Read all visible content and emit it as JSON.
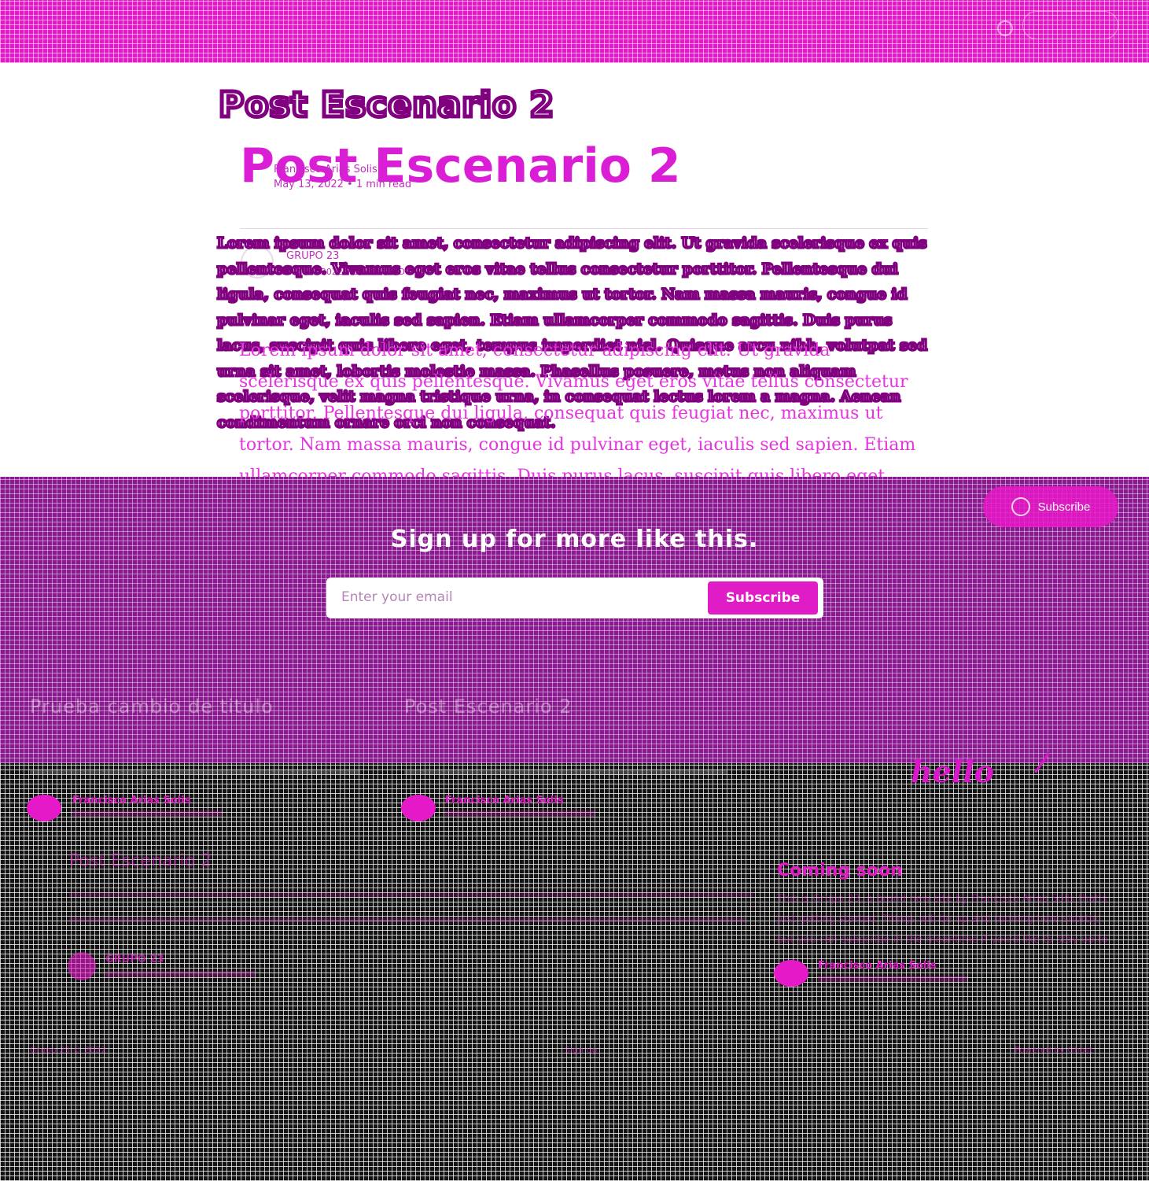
{
  "header": {
    "nav_placeholder": "·",
    "button_label": ""
  },
  "post": {
    "title_outline": "Post Escenario 2",
    "title": "Post Escenario 2",
    "meta_top": {
      "author": "Francisco Arias Solis",
      "date": "May 13, 2022",
      "read_time": "1 min read"
    },
    "meta_bottom": {
      "author": "GRUPO 23",
      "date": "13 MAY 2022",
      "read_time": "1 MIN READ"
    },
    "body_outline": "Lorem ipsum dolor sit amet, consectetur adipiscing elit. Ut gravida scelerisque ex quis pellentesque. Vivamus eget eros vitae tellus consectetur porttitor. Pellentesque dui ligula, consequat quis feugiat nec, maximus ut tortor. Nam massa mauris, congue id pulvinar eget, iaculis sed sapien. Etiam ullamcorper commodo sagittis. Duis purus lacus, suscipit quis libero eget, tempus imperdiet nisl. Quisque arcu nibh, volutpat sed urna sit amet, lobortis molestie massa. Phasellus posuere, metus non aliquam scelerisque, velit magna tristique urna, in consequat lectus lorem a magna. Aenean condimentum ornare orci non consequat.",
    "body": "Lorem ipsum dolor sit amet, consectetur adipiscing elit. Ut gravida scelerisque ex quis pellentesque. Vivamus eget eros vitae tellus consectetur porttitor. Pellentesque dui ligula, consequat quis feugiat nec, maximus ut tortor. Nam massa mauris, congue id pulvinar eget, iaculis sed sapien. Etiam ullamcorper commodo sagittis. Duis purus lacus, suscipit quis libero eget, tempus imperdiet"
  },
  "subscribe": {
    "floating_button": "Subscribe",
    "heading": "Sign up for more like this.",
    "email_placeholder": "Enter your email",
    "button": "Subscribe"
  },
  "related": {
    "left_title": "Prueba cambio de titulo",
    "right_title": "Post Escenario 2"
  },
  "footer": {
    "card_author": "Francisco Arias Solis",
    "featured_title": "Post Escenario 2",
    "featured_author": "GRUPO 23",
    "coming_soon_title": "Coming soon",
    "coming_soon_excerpt": "This is Grupo 23, a brand new site by Francisco Arias Solis that's just getting started. Things will be up and running here shortly, but you can subscribe in the meantime if you'd like to stay up to date and receive emails when new content is published!",
    "coming_soon_author": "Francisco Arias Solis",
    "hello_text": "hello",
    "left_link": "Grupo 23 © 2022",
    "center_link": "Sign up",
    "right_link": "Powered by Ghost"
  },
  "colors": {
    "magenta": "#e619c8",
    "purple": "#8a1a8f",
    "dark": "#141414"
  }
}
